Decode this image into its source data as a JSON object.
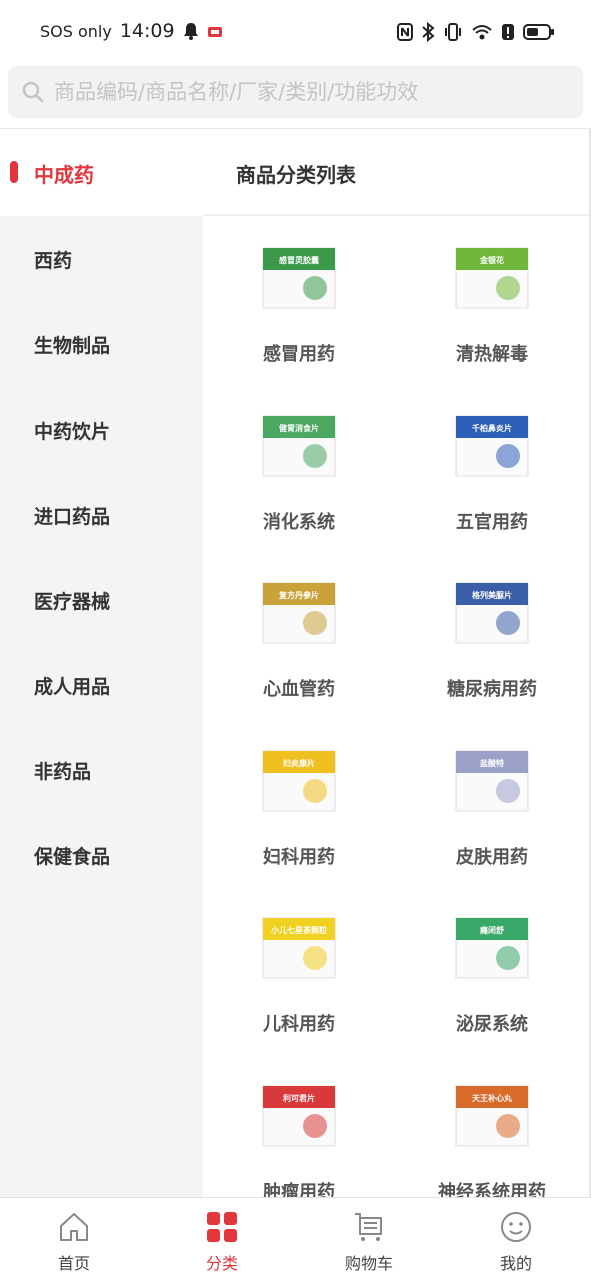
{
  "status": {
    "carrier": "SOS only",
    "time": "14:09"
  },
  "search": {
    "placeholder": "商品编码/商品名称/厂家/类别/功能功效"
  },
  "sidebar": {
    "items": [
      {
        "label": "中成药",
        "active": true
      },
      {
        "label": "西药"
      },
      {
        "label": "生物制品"
      },
      {
        "label": "中药饮片"
      },
      {
        "label": "进口药品"
      },
      {
        "label": "医疗器械"
      },
      {
        "label": "成人用品"
      },
      {
        "label": "非药品"
      },
      {
        "label": "保健食品"
      }
    ]
  },
  "main": {
    "title": "商品分类列表",
    "categories": [
      {
        "label": "感冒用药",
        "box_text": "感冒灵胶囊",
        "color": "#3a9a4a"
      },
      {
        "label": "清热解毒",
        "box_text": "金银花",
        "color": "#6fb83a"
      },
      {
        "label": "消化系统",
        "box_text": "健胃消食片",
        "color": "#4aa860"
      },
      {
        "label": "五官用药",
        "box_text": "千柏鼻炎片",
        "color": "#2e5fb8"
      },
      {
        "label": "心血管药",
        "box_text": "复方丹参片",
        "color": "#c9a23a"
      },
      {
        "label": "糖尿病用药",
        "box_text": "格列美脲片",
        "color": "#3a5fa8"
      },
      {
        "label": "妇科用药",
        "box_text": "妇炎康片",
        "color": "#f0c020"
      },
      {
        "label": "皮肤用药",
        "box_text": "盐酸特",
        "color": "#9aa0c8"
      },
      {
        "label": "儿科用药",
        "box_text": "小儿七星茶颗粒",
        "color": "#f0d020"
      },
      {
        "label": "泌尿系统",
        "box_text": "癃闭舒",
        "color": "#3aa868"
      },
      {
        "label": "肿瘤用药",
        "box_text": "利可君片",
        "color": "#d83a3a"
      },
      {
        "label": "神经系统用药",
        "box_text": "天王补心丸",
        "color": "#d86a2a"
      }
    ]
  },
  "nav": {
    "items": [
      {
        "label": "首页"
      },
      {
        "label": "分类",
        "active": true
      },
      {
        "label": "购物车"
      },
      {
        "label": "我的"
      }
    ]
  },
  "colors": {
    "accent": "#e2363d",
    "sidebar_bg": "#f4f4f4"
  }
}
